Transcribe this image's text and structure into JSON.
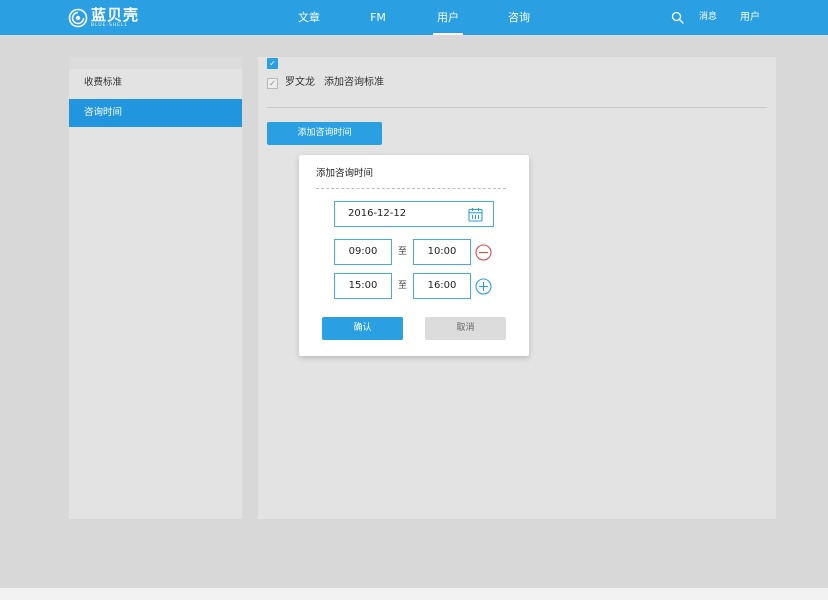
{
  "brand": {
    "name_cn": "蓝贝壳",
    "name_en": "BLUE·SHELL"
  },
  "nav": {
    "items": [
      {
        "label": "文章"
      },
      {
        "label": "FM"
      },
      {
        "label": "用户"
      },
      {
        "label": "咨询"
      }
    ],
    "active": "用户",
    "messages": "消息",
    "user": "用户"
  },
  "sidebar": {
    "items": [
      {
        "label": "收费标准"
      },
      {
        "label": "咨询时间"
      }
    ],
    "active": "咨询时间"
  },
  "main": {
    "row": {
      "name": "罗文龙",
      "link": "添加咨询标准"
    },
    "add_button": "添加咨询时间"
  },
  "dialog": {
    "title": "添加咨询时间",
    "date": "2016-12-12",
    "slots": [
      {
        "start": "09:00",
        "to": "至",
        "end": "10:00",
        "action_icon": "minus-circle-icon"
      },
      {
        "start": "15:00",
        "to": "至",
        "end": "16:00",
        "action_icon": "plus-circle-icon"
      }
    ],
    "confirm": "确认",
    "cancel": "取消"
  },
  "colors": {
    "primary": "#2a9fe2",
    "sidebar_active": "#2196de",
    "danger": "#e0484a",
    "panel": "#e3e3e3",
    "background": "#d8d8d8"
  }
}
